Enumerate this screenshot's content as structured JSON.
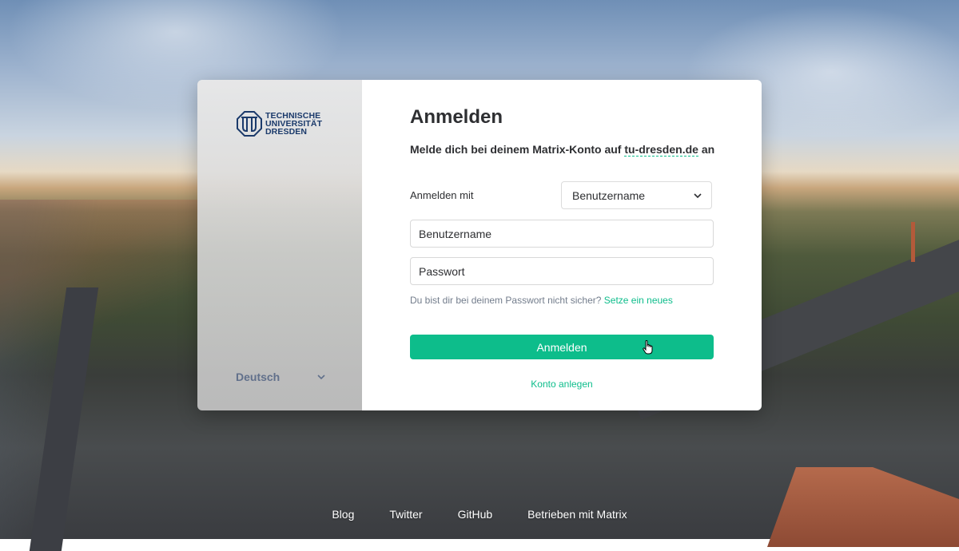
{
  "branding": {
    "logo_lines": [
      "TECHNISCHE",
      "UNIVERSITÄT",
      "DRESDEN"
    ]
  },
  "language": {
    "selected": "Deutsch",
    "icon": "chevron-down-icon"
  },
  "login": {
    "title": "Anmelden",
    "subtitle_prefix": "Melde dich bei deinem Matrix-Konto auf ",
    "server": "tu-dresden.de",
    "subtitle_suffix": " an",
    "login_with_label": "Anmelden mit",
    "login_with_value": "Benutzername",
    "username_placeholder": "Benutzername",
    "password_placeholder": "Passwort",
    "forgot_text": "Du bist dir bei deinem Passwort nicht sicher?",
    "forgot_link": "Setze ein neues",
    "submit_label": "Anmelden",
    "create_account": "Konto anlegen"
  },
  "footer": {
    "links": [
      "Blog",
      "Twitter",
      "GitHub",
      "Betrieben mit Matrix"
    ]
  },
  "colors": {
    "accent": "#0dbd8b",
    "text": "#2e2f32",
    "muted": "#737d8c",
    "brand_blue": "#1b3a6b"
  }
}
